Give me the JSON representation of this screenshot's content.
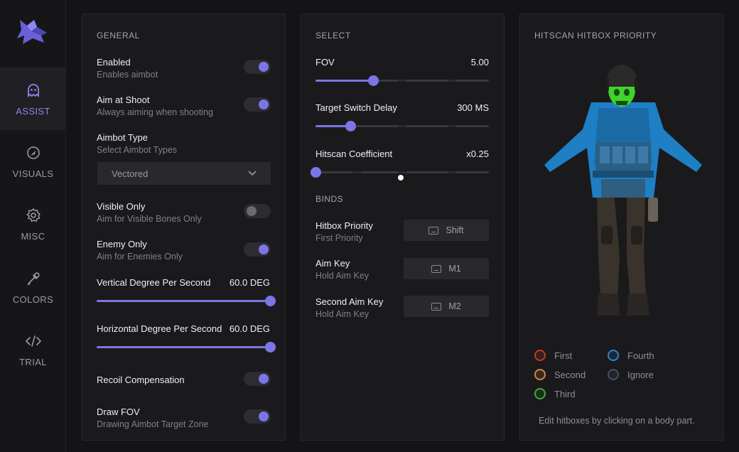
{
  "sidebar": {
    "items": [
      {
        "label": "ASSIST",
        "icon": "ghost-icon",
        "active": true
      },
      {
        "label": "VISUALS",
        "icon": "visuals-icon",
        "active": false
      },
      {
        "label": "MISC",
        "icon": "gear-icon",
        "active": false
      },
      {
        "label": "COLORS",
        "icon": "eyedropper-icon",
        "active": false
      },
      {
        "label": "TRIAL",
        "icon": "code-icon",
        "active": false
      }
    ]
  },
  "general": {
    "title": "GENERAL",
    "enabled": {
      "title": "Enabled",
      "sub": "Enables aimbot",
      "on": true
    },
    "aim_at_shoot": {
      "title": "Aim at Shoot",
      "sub": "Always aiming when shooting",
      "on": true
    },
    "aimbot_type": {
      "title": "Aimbot Type",
      "sub": "Select Aimbot Types",
      "value": "Vectored"
    },
    "visible_only": {
      "title": "Visible Only",
      "sub": "Aim for Visible Bones Only",
      "on": false
    },
    "enemy_only": {
      "title": "Enemy Only",
      "sub": "Aim for Enemies Only",
      "on": true
    },
    "vertical": {
      "label": "Vertical Degree Per Second",
      "value": "60.0 DEG",
      "fraction": 1.0
    },
    "horizontal": {
      "label": "Horizontal Degree Per Second",
      "value": "60.0 DEG",
      "fraction": 1.0
    },
    "recoil": {
      "title": "Recoil Compensation",
      "on": true
    },
    "draw_fov": {
      "title": "Draw FOV",
      "sub": "Drawing Aimbot Target Zone",
      "on": true
    }
  },
  "select": {
    "title": "SELECT",
    "fov": {
      "label": "FOV",
      "value": "5.00",
      "fraction": 0.33
    },
    "switch_delay": {
      "label": "Target Switch Delay",
      "value": "300 MS",
      "fraction": 0.2
    },
    "hitscan": {
      "label": "Hitscan Coefficient",
      "value": "x0.25",
      "fraction": 0.0
    }
  },
  "binds": {
    "title": "BINDS",
    "items": [
      {
        "title": "Hitbox Priority",
        "sub": "First Priority",
        "key": "Shift"
      },
      {
        "title": "Aim Key",
        "sub": "Hold Aim Key",
        "key": "M1"
      },
      {
        "title": "Second Aim Key",
        "sub": "Hold Aim Key",
        "key": "M2"
      }
    ]
  },
  "hitbox": {
    "title": "HITSCAN HITBOX PRIORITY",
    "legend": [
      {
        "label": "First",
        "color": "#c0392b"
      },
      {
        "label": "Fourth",
        "color": "#2e86c1"
      },
      {
        "label": "Second",
        "color": "#d4834a"
      },
      {
        "label": "Ignore",
        "color": "#4a4e60"
      },
      {
        "label": "Third",
        "color": "#3faa3a"
      }
    ],
    "hint": "Edit hitboxes by clicking on a body part."
  },
  "colors": {
    "accent": "#7c75e6",
    "head": "#3fd42a",
    "body": "#1f7fc4"
  }
}
